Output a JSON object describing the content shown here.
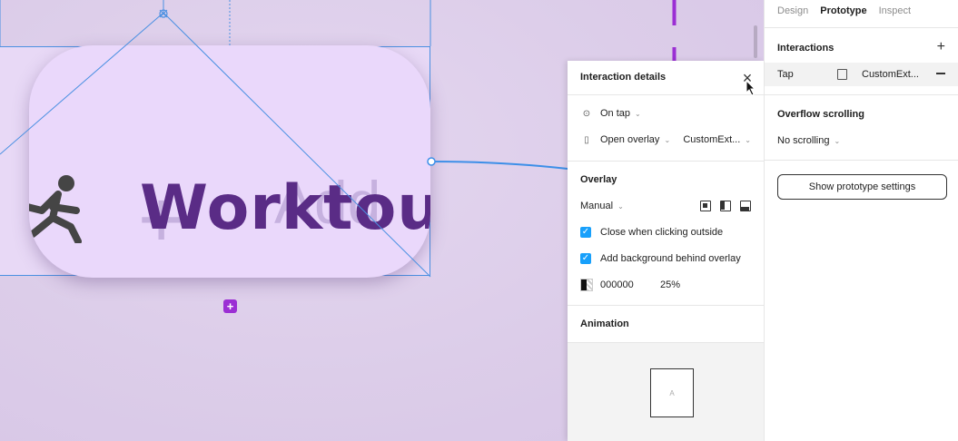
{
  "canvas": {
    "card_title": "Worktout",
    "ghost_text": "Add",
    "ghost_plus": "+"
  },
  "details": {
    "title": "Interaction details",
    "trigger": "On tap",
    "action": "Open overlay",
    "destination": "CustomExt...",
    "overlay_title": "Overlay",
    "position": "Manual",
    "close_outside_label": "Close when clicking outside",
    "add_bg_label": "Add background behind overlay",
    "bg_color": "000000",
    "bg_opacity": "25%",
    "animation_title": "Animation",
    "preview_label": "A"
  },
  "panel": {
    "tabs": [
      "Design",
      "Prototype",
      "Inspect"
    ],
    "interactions_title": "Interactions",
    "interaction": {
      "trigger": "Tap",
      "target": "CustomExt..."
    },
    "overflow_title": "Overflow scrolling",
    "overflow_value": "No scrolling",
    "show_settings_label": "Show prototype settings"
  },
  "colors": {
    "accent": "#18a0fb",
    "selection": "#4a90e2",
    "purple_node": "#9b2fd4",
    "card_text": "#5a2c86"
  }
}
